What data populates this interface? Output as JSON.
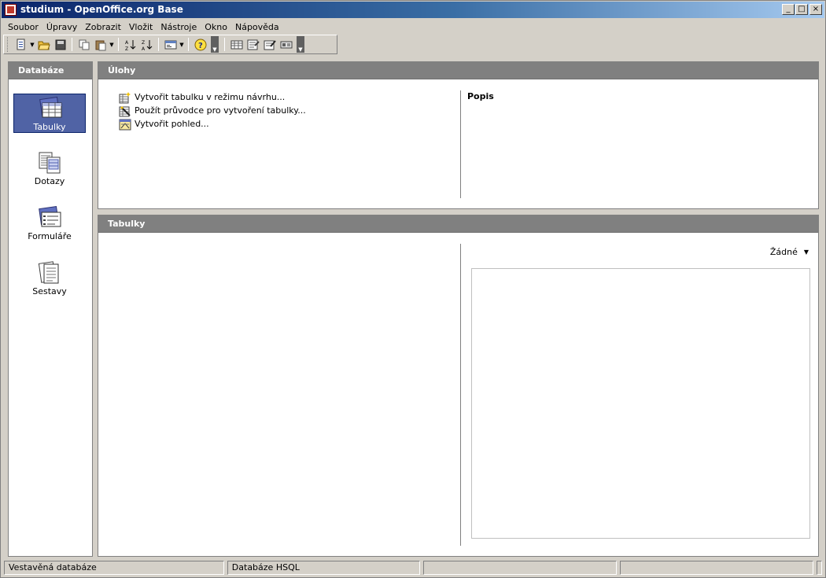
{
  "window": {
    "title": "studium - OpenOffice.org Base",
    "minimize_glyph": "_",
    "maximize_glyph": "□",
    "close_glyph": "×"
  },
  "menu": {
    "items": [
      "Soubor",
      "Úpravy",
      "Zobrazit",
      "Vložit",
      "Nástroje",
      "Okno",
      "Nápověda"
    ]
  },
  "toolbar": {
    "buttons": [
      "new-document-icon",
      "open-folder-icon",
      "save-icon",
      "copy-icon",
      "paste-icon",
      "sort-ascending-icon",
      "sort-descending-icon",
      "form-icon",
      "help-icon",
      "table-icon",
      "query-icon",
      "form-edit-icon",
      "report-icon"
    ]
  },
  "left_panel": {
    "header": "Databáze",
    "items": [
      {
        "label": "Tabulky",
        "icon": "tables-icon",
        "selected": true
      },
      {
        "label": "Dotazy",
        "icon": "queries-icon",
        "selected": false
      },
      {
        "label": "Formuláře",
        "icon": "forms-icon",
        "selected": false
      },
      {
        "label": "Sestavy",
        "icon": "reports-icon",
        "selected": false
      }
    ]
  },
  "tasks_panel": {
    "header": "Úlohy",
    "tasks": [
      {
        "label": "Vytvořit tabulku v režimu návrhu...",
        "icon": "design-table-icon"
      },
      {
        "label": "Použít průvodce pro vytvoření tabulky...",
        "icon": "wizard-icon"
      },
      {
        "label": "Vytvořit pohled...",
        "icon": "view-icon"
      }
    ],
    "description_label": "Popis"
  },
  "tables_panel": {
    "header": "Tabulky",
    "preview_mode": "Žádné"
  },
  "statusbar": {
    "cells": [
      "Vestavěná databáze",
      "Databáze HSQL",
      "",
      "",
      ""
    ]
  },
  "colors": {
    "title_start": "#0a246a",
    "selection": "#5063a5",
    "panel_header": "#808080",
    "chrome": "#d4d0c8"
  }
}
